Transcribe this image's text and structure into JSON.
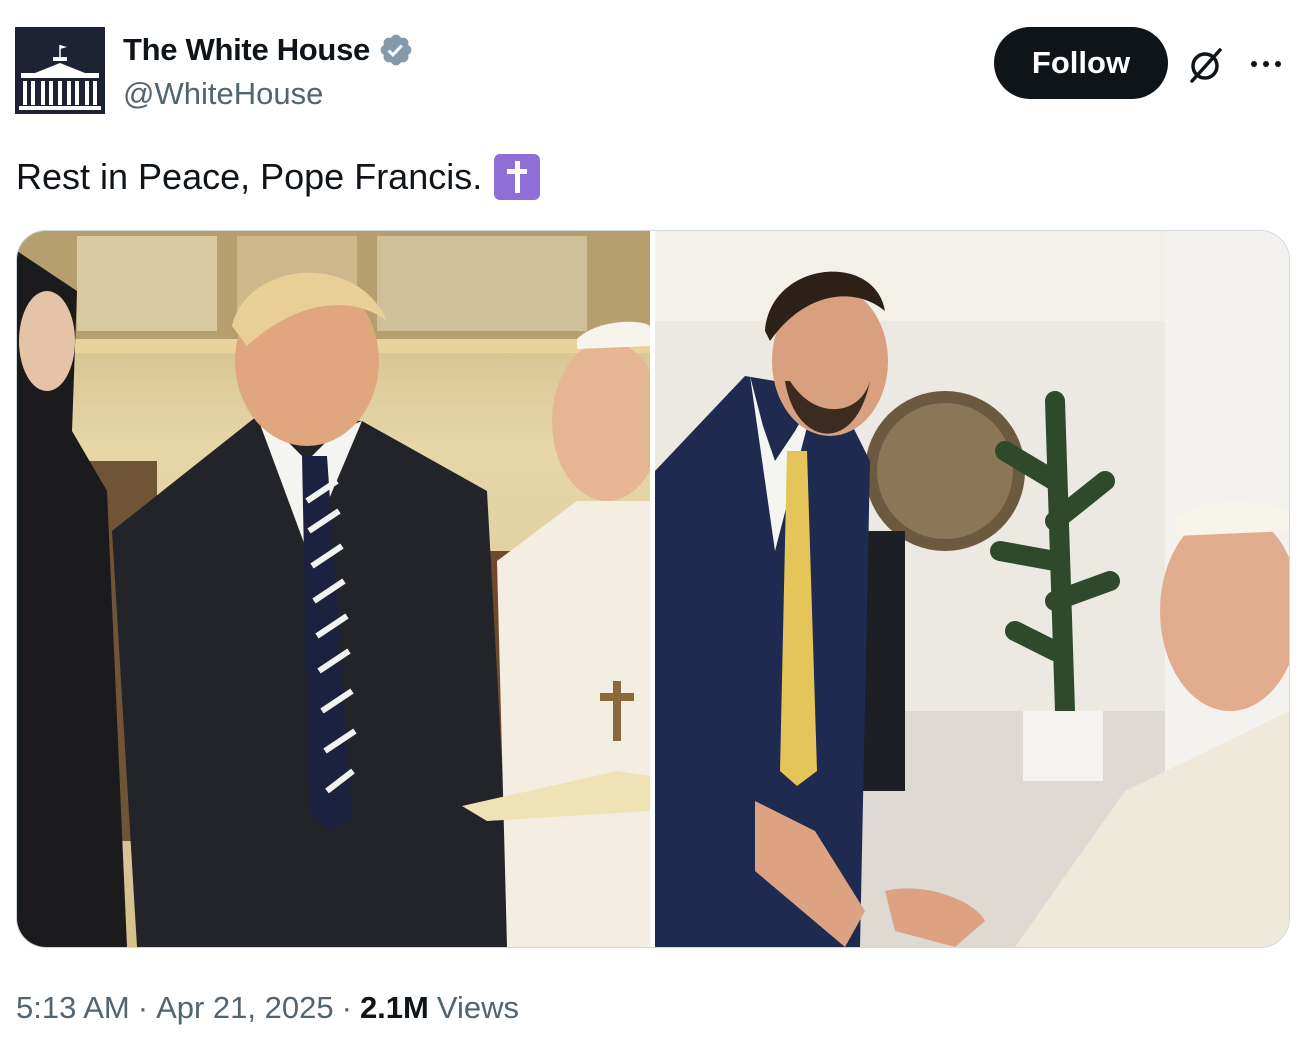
{
  "account": {
    "display_name": "The White House",
    "handle": "@WhiteHouse",
    "verified": true,
    "avatar": "white-house-logo"
  },
  "header": {
    "follow_label": "Follow",
    "grok_icon": "grok-icon",
    "more_icon": "more-options-icon"
  },
  "tweet": {
    "text": "Rest in Peace, Pope Francis.",
    "emoji": "latin-cross-emoji",
    "emoji_char": "✝️"
  },
  "media": {
    "count": 2,
    "photos": [
      {
        "name": "photo-trump-pope"
      },
      {
        "name": "photo-vance-pope"
      }
    ]
  },
  "meta": {
    "time": "5:13 AM",
    "separator": "·",
    "date": "Apr 21, 2025",
    "views_count": "2.1M",
    "views_label": "Views"
  },
  "colors": {
    "text_primary": "#0f1419",
    "text_secondary": "#536471",
    "follow_bg": "#0f1419",
    "verified": "#829aab",
    "emoji_bg": "#8e6fd8",
    "border": "#cfd9de"
  }
}
